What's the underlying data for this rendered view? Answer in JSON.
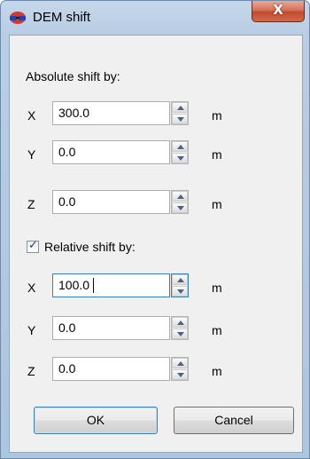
{
  "window": {
    "title": "DEM shift",
    "close_glyph": "X",
    "icon": "dem-shift-icon"
  },
  "absolute": {
    "section_label": "Absolute shift by:",
    "rows": [
      {
        "axis": "X",
        "value": "300.0",
        "unit": "m"
      },
      {
        "axis": "Y",
        "value": "0.0",
        "unit": "m"
      },
      {
        "axis": "Z",
        "value": "0.0",
        "unit": "m"
      }
    ]
  },
  "relative": {
    "checkbox_label": "Relative shift by:",
    "checked": true,
    "rows": [
      {
        "axis": "X",
        "value": "100.0",
        "unit": "m"
      },
      {
        "axis": "Y",
        "value": "0.0",
        "unit": "m"
      },
      {
        "axis": "Z",
        "value": "0.0",
        "unit": "m"
      }
    ]
  },
  "buttons": {
    "ok_label": "OK",
    "cancel_label": "Cancel"
  },
  "colors": {
    "title_bar": "#b9cde4",
    "close_button": "#c24a30",
    "client_background": "#f0f0f0",
    "focus_border": "#3c7fb1"
  }
}
